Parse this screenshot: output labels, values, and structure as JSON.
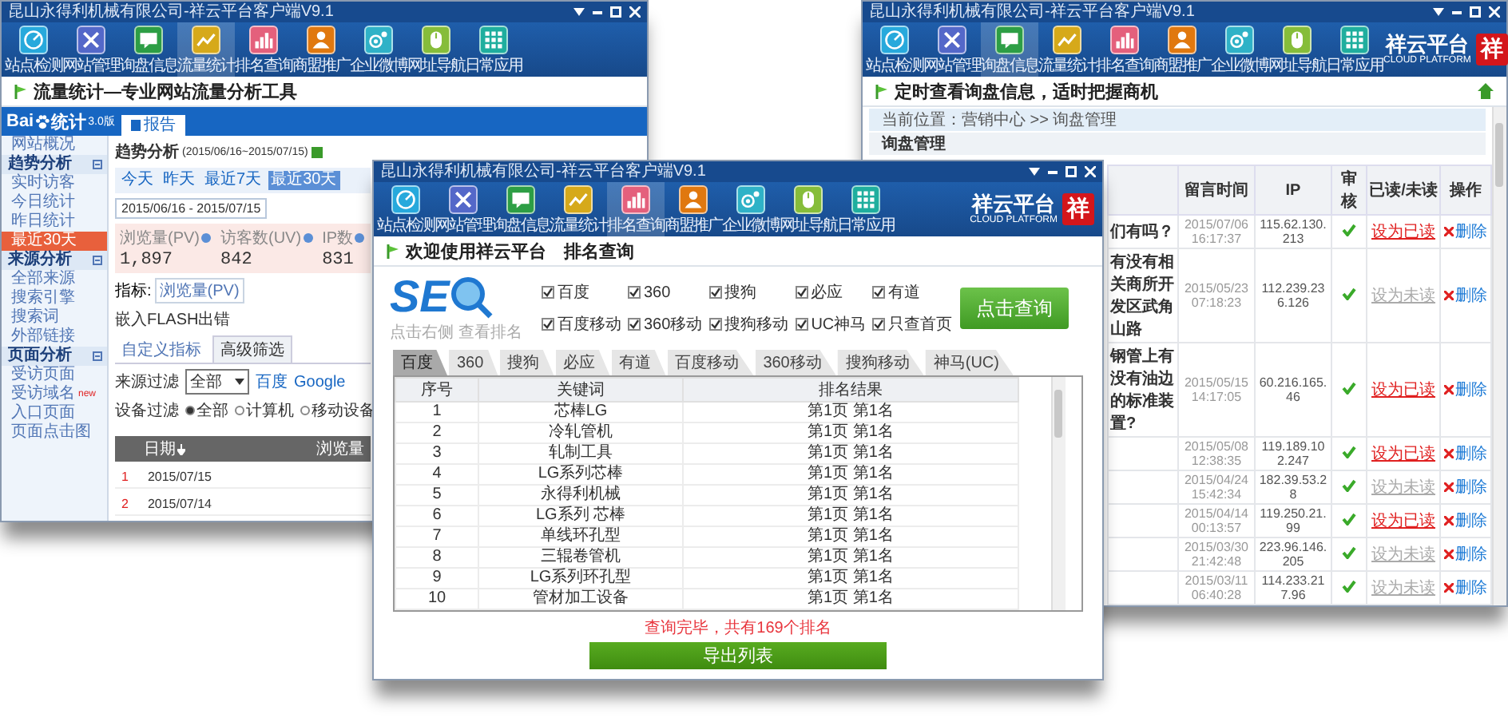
{
  "traffic_window": {
    "title": "昆山永得利机械有限公司-祥云平台客户端V9.1",
    "nav": [
      {
        "label": "站点检测",
        "selected": false
      },
      {
        "label": "网站管理",
        "selected": false
      },
      {
        "label": "询盘信息",
        "selected": false
      },
      {
        "label": "流量统计",
        "selected": true
      },
      {
        "label": "排名查询",
        "selected": false
      },
      {
        "label": "商盟推广",
        "selected": false
      },
      {
        "label": "企业微博",
        "selected": false
      },
      {
        "label": "网址导航",
        "selected": false
      },
      {
        "label": "日常应用",
        "selected": false
      }
    ],
    "header": "流量统计—专业网站流量分析工具",
    "stats_logo": {
      "prefix": "Bai",
      "suffix": "统计",
      "version": "3.0版"
    },
    "report_tab": "报告",
    "sidebar": [
      {
        "label": "网站概况",
        "kind": "item",
        "selected": false
      },
      {
        "label": "趋势分析",
        "kind": "section",
        "selected": false
      },
      {
        "label": "实时访客",
        "kind": "item",
        "selected": false
      },
      {
        "label": "今日统计",
        "kind": "item",
        "selected": false
      },
      {
        "label": "昨日统计",
        "kind": "item",
        "selected": false
      },
      {
        "label": "最近30天",
        "kind": "item",
        "selected": true
      },
      {
        "label": "来源分析",
        "kind": "section",
        "selected": false
      },
      {
        "label": "全部来源",
        "kind": "item",
        "selected": false
      },
      {
        "label": "搜索引擎",
        "kind": "item",
        "selected": false
      },
      {
        "label": "搜索词",
        "kind": "item",
        "selected": false
      },
      {
        "label": "外部链接",
        "kind": "item",
        "selected": false
      },
      {
        "label": "页面分析",
        "kind": "section",
        "selected": false
      },
      {
        "label": "受访页面",
        "kind": "item",
        "selected": false
      },
      {
        "label": "受访域名",
        "kind": "item",
        "selected": false,
        "badge": "new"
      },
      {
        "label": "入口页面",
        "kind": "item",
        "selected": false
      },
      {
        "label": "页面点击图",
        "kind": "item",
        "selected": false
      }
    ],
    "trend_title": "趋势分析",
    "trend_range": "(2015/06/16~2015/07/15)",
    "date_buttons": [
      {
        "label": "今天",
        "selected": false
      },
      {
        "label": "昨天",
        "selected": false
      },
      {
        "label": "最近7天",
        "selected": false
      },
      {
        "label": "最近30天",
        "selected": true
      }
    ],
    "date_picker": "2015/06/16 - 2015/07/15",
    "stats": [
      {
        "label": "浏览量(PV)",
        "value": "1,897"
      },
      {
        "label": "访客数(UV)",
        "value": "842"
      },
      {
        "label": "IP数",
        "value": "831"
      }
    ],
    "metric": {
      "label": "指标:",
      "value": "浏览量(PV)"
    },
    "flash_error": "嵌入FLASH出错",
    "filter_tabs": [
      {
        "label": "自定义指标",
        "selected": false
      },
      {
        "label": "高级筛选",
        "selected": true
      }
    ],
    "source_filter": {
      "label": "来源过滤",
      "value": "全部",
      "links": [
        "百度",
        "Google"
      ]
    },
    "device_filter": {
      "label": "设备过滤",
      "options": [
        {
          "label": "全部",
          "selected": true
        },
        {
          "label": "计算机",
          "selected": false
        },
        {
          "label": "移动设备",
          "selected": false
        }
      ]
    },
    "table": {
      "columns": [
        "日期",
        "浏览量"
      ],
      "rows": [
        {
          "index": "1",
          "date": "2015/07/15"
        },
        {
          "index": "2",
          "date": "2015/07/14"
        }
      ]
    }
  },
  "inquiry_window": {
    "title": "昆山永得利机械有限公司-祥云平台客户端V9.1",
    "nav": [
      {
        "label": "站点检测",
        "selected": false
      },
      {
        "label": "网站管理",
        "selected": false
      },
      {
        "label": "询盘信息",
        "selected": true
      },
      {
        "label": "流量统计",
        "selected": false
      },
      {
        "label": "排名查询",
        "selected": false
      },
      {
        "label": "商盟推广",
        "selected": false
      },
      {
        "label": "企业微博",
        "selected": false
      },
      {
        "label": "网址导航",
        "selected": false
      },
      {
        "label": "日常应用",
        "selected": false
      }
    ],
    "logo": {
      "name": "祥云平台",
      "subtitle": "CLOUD PLATFORM",
      "badge": "祥"
    },
    "header": "定时查看询盘信息，适时把握商机",
    "breadcrumb": "当前位置：营销中心 >> 询盘管理",
    "section": "询盘管理",
    "columns": [
      "留言时间",
      "IP",
      "审核",
      "已读/未读",
      "操作"
    ],
    "rows": [
      {
        "snippet": "们有吗？",
        "time": "2015/07/06 16:17:37",
        "ip": "115.62.130.213",
        "read": false,
        "toggle": "设为已读",
        "action": "删除"
      },
      {
        "snippet": "有没有相关商所开发区武角山路",
        "time": "2015/05/23 07:18:23",
        "ip": "112.239.236.126",
        "read": true,
        "toggle": "设为未读",
        "action": "删除"
      },
      {
        "snippet": "钢管上有没有油边的标准装置?",
        "time": "2015/05/15 14:17:05",
        "ip": "60.216.165.46",
        "read": false,
        "toggle": "设为已读",
        "action": "删除"
      },
      {
        "time": "2015/05/08 12:38:35",
        "ip": "119.189.102.247",
        "read": false,
        "toggle": "设为已读",
        "action": "删除"
      },
      {
        "time": "2015/04/24 15:42:34",
        "ip": "182.39.53.28",
        "read": true,
        "toggle": "设为未读",
        "action": "删除"
      },
      {
        "time": "2015/04/14 00:13:57",
        "ip": "119.250.21.99",
        "read": false,
        "toggle": "设为已读",
        "action": "删除"
      },
      {
        "time": "2015/03/30 21:42:48",
        "ip": "223.96.146.205",
        "read": true,
        "toggle": "设为未读",
        "action": "删除"
      },
      {
        "time": "2015/03/11 06:40:28",
        "ip": "114.233.217.96",
        "read": true,
        "toggle": "设为未读",
        "action": "删除"
      }
    ]
  },
  "ranking_window": {
    "title": "昆山永得利机械有限公司-祥云平台客户端V9.1",
    "nav": [
      {
        "label": "站点检测",
        "selected": false
      },
      {
        "label": "网站管理",
        "selected": false
      },
      {
        "label": "询盘信息",
        "selected": false
      },
      {
        "label": "流量统计",
        "selected": false
      },
      {
        "label": "排名查询",
        "selected": true
      },
      {
        "label": "商盟推广",
        "selected": false
      },
      {
        "label": "企业微博",
        "selected": false
      },
      {
        "label": "网址导航",
        "selected": false
      },
      {
        "label": "日常应用",
        "selected": false
      }
    ],
    "logo": {
      "name": "祥云平台",
      "subtitle": "CLOUD PLATFORM",
      "badge": "祥"
    },
    "header": "欢迎使用祥云平台　排名查询",
    "seo_logo": {
      "text": "SE",
      "caption": "点击右侧 查看排名"
    },
    "engines": [
      {
        "label": "百度",
        "checked": true
      },
      {
        "label": "360",
        "checked": true
      },
      {
        "label": "搜狗",
        "checked": true
      },
      {
        "label": "必应",
        "checked": true
      },
      {
        "label": "有道",
        "checked": true
      },
      {
        "label": "百度移动",
        "checked": true
      },
      {
        "label": "360移动",
        "checked": true
      },
      {
        "label": "搜狗移动",
        "checked": true
      },
      {
        "label": "UC神马",
        "checked": true
      },
      {
        "label": "只查首页",
        "checked": true
      }
    ],
    "query_button": "点击查询",
    "tabs": [
      {
        "label": "百度",
        "selected": true
      },
      {
        "label": "360",
        "selected": false
      },
      {
        "label": "搜狗",
        "selected": false
      },
      {
        "label": "必应",
        "selected": false
      },
      {
        "label": "有道",
        "selected": false
      },
      {
        "label": "百度移动",
        "selected": false
      },
      {
        "label": "360移动",
        "selected": false
      },
      {
        "label": "搜狗移动",
        "selected": false
      },
      {
        "label": "神马(UC)",
        "selected": false
      }
    ],
    "columns": [
      "序号",
      "关键词",
      "排名结果"
    ],
    "rows": [
      {
        "no": "1",
        "keyword": "芯棒LG",
        "result": "第1页 第1名"
      },
      {
        "no": "2",
        "keyword": "冷轧管机",
        "result": "第1页 第1名"
      },
      {
        "no": "3",
        "keyword": "轧制工具",
        "result": "第1页 第1名"
      },
      {
        "no": "4",
        "keyword": "LG系列芯棒",
        "result": "第1页 第1名"
      },
      {
        "no": "5",
        "keyword": "永得利机械",
        "result": "第1页 第1名"
      },
      {
        "no": "6",
        "keyword": "LG系列 芯棒",
        "result": "第1页 第1名"
      },
      {
        "no": "7",
        "keyword": "单线环孔型",
        "result": "第1页 第1名"
      },
      {
        "no": "8",
        "keyword": "三辊卷管机",
        "result": "第1页 第1名"
      },
      {
        "no": "9",
        "keyword": "LG系列环孔型",
        "result": "第1页 第1名"
      },
      {
        "no": "10",
        "keyword": "管材加工设备",
        "result": "第1页 第1名"
      }
    ],
    "status": "查询完毕，共有169个排名",
    "export_button": "导出列表"
  }
}
